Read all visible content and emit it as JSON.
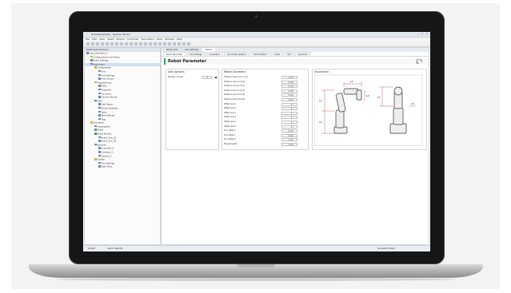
{
  "window": {
    "title": "RobotSample01 - Sysmac Studio",
    "controls": [
      "_",
      "□",
      "×"
    ]
  },
  "menu": [
    "File",
    "Edit",
    "View",
    "Insert",
    "Project",
    "Controller",
    "Simulation",
    "Tools",
    "Window",
    "Help"
  ],
  "tree": {
    "header": "Multiview Explorer",
    "rows": [
      {
        "label": "new_Controller_0",
        "indent": 0,
        "kind": "b"
      },
      {
        "label": "Configurations and Setup",
        "indent": 1,
        "kind": "y"
      },
      {
        "label": "Robot Settings",
        "indent": 1,
        "kind": "b"
      },
      {
        "label": "Application",
        "indent": 1,
        "kind": "b",
        "sel": true
      },
      {
        "label": "Configuration",
        "indent": 2,
        "kind": "y"
      },
      {
        "label": "Axis",
        "indent": 3,
        "kind": "b"
      },
      {
        "label": "Axis Settings",
        "indent": 3,
        "kind": "b"
      },
      {
        "label": "Axis Groups",
        "indent": 3,
        "kind": "b"
      },
      {
        "label": "Programming",
        "indent": 2,
        "kind": "y"
      },
      {
        "label": "POUs",
        "indent": 3,
        "kind": "b"
      },
      {
        "label": "Programs",
        "indent": 3,
        "kind": "b"
      },
      {
        "label": "Functions",
        "indent": 3,
        "kind": "b"
      },
      {
        "label": "Function Blocks",
        "indent": 3,
        "kind": "b"
      },
      {
        "label": "Data",
        "indent": 2,
        "kind": "g"
      },
      {
        "label": "Data Types",
        "indent": 3,
        "kind": "b"
      },
      {
        "label": "Global Variables",
        "indent": 3,
        "kind": "b"
      },
      {
        "label": "Tasks",
        "indent": 3,
        "kind": "b"
      },
      {
        "label": "Task Settings",
        "indent": 3,
        "kind": "b"
      },
      {
        "label": "Tags",
        "indent": 3,
        "kind": "b"
      },
      {
        "label": "Simulation",
        "indent": 1,
        "kind": "y"
      },
      {
        "label": "Visualization",
        "indent": 2,
        "kind": "b"
      },
      {
        "label": "Robot",
        "indent": 2,
        "kind": "b"
      },
      {
        "label": "Robot Models",
        "indent": 2,
        "kind": "g"
      },
      {
        "label": "Robot_Arm_01",
        "indent": 3,
        "kind": "b"
      },
      {
        "label": "Robot_Arm_02",
        "indent": 3,
        "kind": "b"
      },
      {
        "label": "Workcell",
        "indent": 2,
        "kind": "b"
      },
      {
        "label": "Controller_0",
        "indent": 3,
        "kind": "b"
      },
      {
        "label": "Conveyor_1",
        "indent": 3,
        "kind": "b"
      },
      {
        "label": "Camera_1",
        "indent": 3,
        "kind": "b"
      },
      {
        "label": "Gripper",
        "indent": 2,
        "kind": "y"
      },
      {
        "label": "Tool Settings",
        "indent": 3,
        "kind": "b"
      },
      {
        "label": "Data Trace",
        "indent": 3,
        "kind": "b"
      }
    ]
  },
  "document_tabs": [
    "Robot_Arm",
    "Axis Settings",
    "Robot"
  ],
  "sub_tabs": [
    "Robot Parameter",
    "Axis Settings",
    "Kinematics",
    "Coordinate Systems",
    "Home Position",
    "Limits",
    "Tool",
    "Dynamics"
  ],
  "page_title": "Robot Parameter",
  "axis_options": {
    "title": "Axis options",
    "label": "Number of axes",
    "value": "6"
  },
  "geometry": {
    "title": "Robot Geometry",
    "rows": [
      {
        "label": "Distance base axis 1 (L1)",
        "value": "0 mm"
      },
      {
        "label": "Distance axis 1-2 (L2)",
        "value": "0 mm"
      },
      {
        "label": "Distance axis 2-3 (L3)",
        "value": "0 mm"
      },
      {
        "label": "Distance axis 3-4 (L4)",
        "value": "0 mm"
      },
      {
        "label": "Distance axis 4-5 (L5)",
        "value": "0 mm"
      },
      {
        "label": "Distance axis 5-6 (L6)",
        "value": "0 mm"
      },
      {
        "label": "Offset axis 1",
        "value": "0 °"
      },
      {
        "label": "Offset axis 2",
        "value": "0 °"
      },
      {
        "label": "Offset axis 3",
        "value": "0 °"
      },
      {
        "label": "Offset axis 4",
        "value": "0 °"
      },
      {
        "label": "Offset axis 5",
        "value": "0 °"
      },
      {
        "label": "Offset axis 6",
        "value": "0 °"
      },
      {
        "label": "Tool offset X",
        "value": "0 mm"
      },
      {
        "label": "Tool offset Y",
        "value": "0 mm"
      },
      {
        "label": "Tool offset Z",
        "value": "0 mm"
      },
      {
        "label": "Flange height",
        "value": "0 mm"
      }
    ]
  },
  "illustration": {
    "title": "Illustration",
    "labels": [
      "L1",
      "L2",
      "L3",
      "L4",
      "L5",
      "L6"
    ]
  },
  "status": {
    "left": "Output",
    "middle": "Search Results",
    "right": "Simulation Mode"
  },
  "colors": {
    "accent": "#2ea84a",
    "link_blue": "#3a6fb5",
    "drawing_red": "#c0392b"
  }
}
